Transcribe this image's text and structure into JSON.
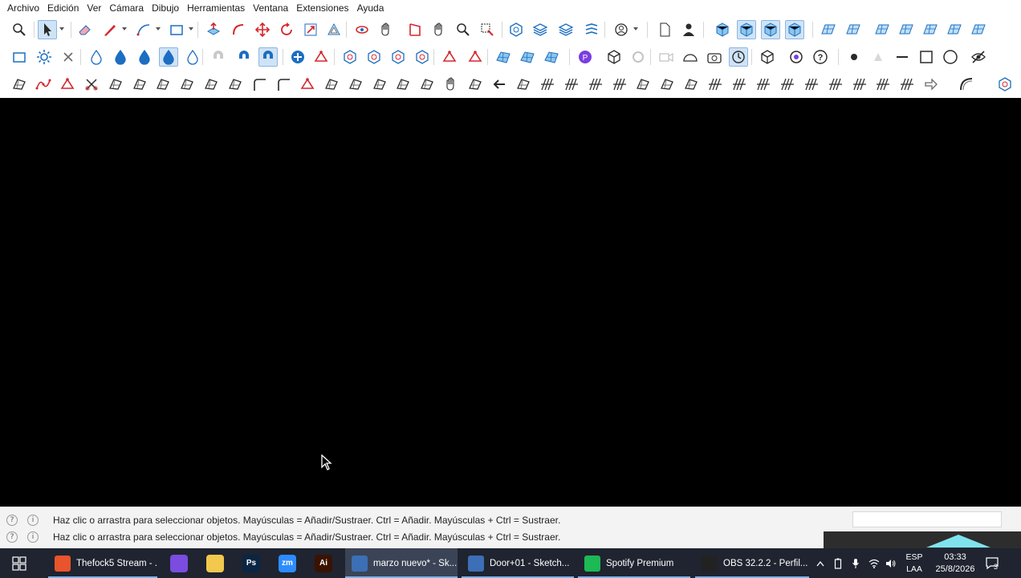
{
  "menu": [
    "Archivo",
    "Edición",
    "Ver",
    "Cámara",
    "Dibujo",
    "Herramientas",
    "Ventana",
    "Extensiones",
    "Ayuda"
  ],
  "toolbar1": [
    {
      "icon": "zoom-extents-icon",
      "active": false
    },
    {
      "icon": "select-icon",
      "active": true,
      "caret": true
    },
    {
      "icon": "eraser-icon",
      "active": false
    },
    {
      "icon": "pencil-line-icon",
      "active": false,
      "caret": true
    },
    {
      "icon": "arc-icon",
      "active": false,
      "caret": true
    },
    {
      "icon": "rectangle-icon",
      "active": false,
      "caret": true
    },
    {
      "icon": "push-pull-icon",
      "active": false
    },
    {
      "icon": "follow-me-icon",
      "active": false
    },
    {
      "icon": "move-icon",
      "active": false
    },
    {
      "icon": "rotate-icon",
      "active": false
    },
    {
      "icon": "scale-icon",
      "active": false
    },
    {
      "icon": "offset-icon",
      "active": false
    },
    {
      "icon": "orbit-icon",
      "active": false
    },
    {
      "icon": "pan-icon",
      "active": false
    },
    {
      "icon": "section-plane-icon",
      "active": false
    },
    {
      "icon": "hand-icon",
      "active": false
    },
    {
      "icon": "zoom-icon",
      "active": false
    },
    {
      "icon": "zoom-window-icon",
      "active": false
    },
    {
      "icon": "components-icon",
      "active": false
    },
    {
      "icon": "tags-icon",
      "active": false
    },
    {
      "icon": "layers-icon",
      "active": false
    },
    {
      "icon": "styles-icon",
      "active": false
    },
    {
      "icon": "account-icon",
      "active": false,
      "caret": true
    },
    {
      "icon": "new-file-icon",
      "active": false
    },
    {
      "icon": "user-icon",
      "active": false
    },
    {
      "icon": "view-iso-icon",
      "active": false
    },
    {
      "icon": "view-top-icon",
      "active": true
    },
    {
      "icon": "view-front-icon",
      "active": true
    },
    {
      "icon": "view-shaded-icon",
      "active": true
    },
    {
      "icon": "sandbox-contours-icon",
      "active": false
    },
    {
      "icon": "sandbox-scratch-icon",
      "active": false
    },
    {
      "icon": "smoove-icon",
      "active": false
    },
    {
      "icon": "stamp-icon",
      "active": false
    },
    {
      "icon": "drape-icon",
      "active": false
    },
    {
      "icon": "add-detail-icon",
      "active": false
    },
    {
      "icon": "flip-edge-icon",
      "active": false
    }
  ],
  "toolbar2": [
    {
      "icon": "rectangle-outline-icon"
    },
    {
      "icon": "gear-icon"
    },
    {
      "icon": "close-x-icon"
    },
    {
      "icon": "drop-outline-icon"
    },
    {
      "icon": "drop-half-icon"
    },
    {
      "icon": "drop-filled-icon"
    },
    {
      "icon": "drop-active-icon",
      "active": true
    },
    {
      "icon": "drop-hatched-icon"
    },
    {
      "icon": "magnet-faded-icon"
    },
    {
      "icon": "magnet-icon"
    },
    {
      "icon": "magnet-active-icon",
      "active": true
    },
    {
      "icon": "add-circle-icon"
    },
    {
      "icon": "red-line-icon"
    },
    {
      "icon": "hexagon-1-icon"
    },
    {
      "icon": "hexagon-2-icon"
    },
    {
      "icon": "hexagon-3-icon"
    },
    {
      "icon": "hexagon-4-icon"
    },
    {
      "icon": "red-cross-icon"
    },
    {
      "icon": "red-rotate-icon"
    },
    {
      "icon": "mesh-1-icon"
    },
    {
      "icon": "mesh-2-icon"
    },
    {
      "icon": "mesh-3-icon"
    },
    {
      "icon": "purple-plugin-icon"
    },
    {
      "icon": "box-icon"
    },
    {
      "icon": "circle-faded-icon"
    },
    {
      "icon": "camera-faded-icon"
    },
    {
      "icon": "dome-icon"
    },
    {
      "icon": "camera-icon"
    },
    {
      "icon": "refresh-active-icon",
      "active": true
    },
    {
      "icon": "cube-icon"
    },
    {
      "icon": "flower-icon"
    },
    {
      "icon": "help-icon"
    },
    {
      "icon": "dot-icon"
    },
    {
      "icon": "triangle-faded-icon"
    },
    {
      "icon": "dash-icon"
    },
    {
      "icon": "square-icon"
    },
    {
      "icon": "circle-icon"
    },
    {
      "icon": "eye-off-icon"
    }
  ],
  "toolbar3": [
    "curve-edit-icon",
    "spline-icon",
    "red-shape-icon",
    "scissors-icon",
    "shape-1-icon",
    "shape-2-icon",
    "pipe-icon",
    "box-shape-icon",
    "sphere-icon",
    "sweep-icon",
    "fillet-icon",
    "chamfer-icon",
    "red-line-tool-icon",
    "loft-icon",
    "frame-icon",
    "fan-icon",
    "columns-icon",
    "grid-icon",
    "hand-tool-icon",
    "profile-icon",
    "arrow-left-icon",
    "stair-icon",
    "hatch-1-icon",
    "hatch-2-icon",
    "hatch-3-icon",
    "hatch-4-icon",
    "brick-icon",
    "panel-1-icon",
    "panel-2-icon",
    "texture-1-icon",
    "texture-2-icon",
    "texture-3-icon",
    "texture-4-icon",
    "texture-5-icon",
    "texture-6-icon",
    "texture-7-icon",
    "texture-8-icon",
    "texture-9-icon",
    "arrow-shape-icon",
    "bend-icon",
    "hexagons-icon"
  ],
  "status": {
    "line1": "Haz clic o arrastra para seleccionar objetos. Mayúsculas = Añadir/Sustraer. Ctrl = Añadir. Mayúsculas + Ctrl = Sustraer.",
    "line2": "Haz clic o arrastra para seleccionar objetos. Mayúsculas = Añadir/Sustraer. Ctrl = Añadir. Mayúsculas + Ctrl = Sustraer."
  },
  "taskbar": {
    "windows": [
      {
        "label": "Thefock5 Stream - ...",
        "icon": "brave-icon",
        "color": "#e8542b"
      },
      {
        "label": "marzo nuevo* - Sk...",
        "icon": "sketchup-icon",
        "color": "#3c6fb6",
        "active": true
      },
      {
        "label": "Door+01 - Sketch...",
        "icon": "sketchup-icon",
        "color": "#3c6fb6"
      },
      {
        "label": "Spotify Premium",
        "icon": "spotify-icon",
        "color": "#1db954"
      },
      {
        "label": "OBS 32.2.2 - Perfil...",
        "icon": "obs-icon",
        "color": "#222222"
      }
    ],
    "pinned": [
      {
        "icon": "discord-icon",
        "color": "#7a4ce0",
        "text": ""
      },
      {
        "icon": "folder-icon",
        "color": "#f2c94c",
        "text": ""
      },
      {
        "icon": "photoshop-icon",
        "color": "#0a2642",
        "text": "Ps"
      },
      {
        "icon": "zoom-app-icon",
        "color": "#2d8cff",
        "text": "zm"
      },
      {
        "icon": "illustrator-icon",
        "color": "#3a1300",
        "text": "Ai"
      }
    ],
    "lang_top": "ESP",
    "lang_bottom": "LAA",
    "time": "03:33",
    "date": "25/8/2026",
    "notification_count": "3"
  }
}
